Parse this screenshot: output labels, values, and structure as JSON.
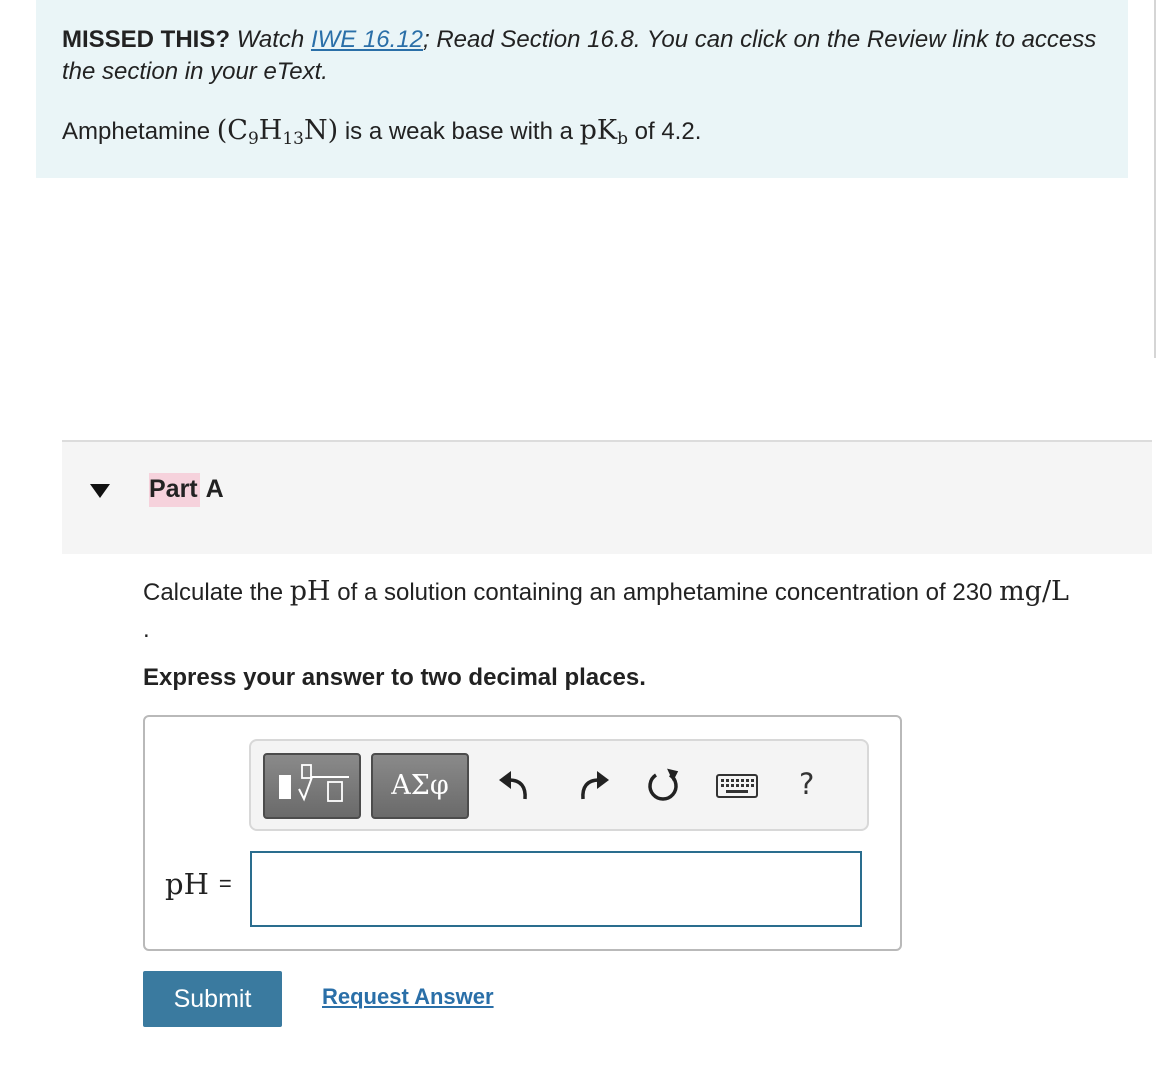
{
  "intro": {
    "missed_lead": "MISSED THIS?",
    "watch_prefix": "Watch",
    "watch_link": "IWE 16.12",
    "missed_rest": "; Read Section 16.8. You can click on the Review link to access the section in your eText.",
    "amph_prefix": "Amphetamine",
    "formula_open": "(C",
    "formula_sub1": "9",
    "formula_mid": "H",
    "formula_sub2": "13",
    "formula_close": "N)",
    "amph_mid": "is a weak base with a",
    "pkb_main": "pK",
    "pkb_sub": "b",
    "amph_suffix": "of 4.2."
  },
  "part": {
    "label_highlight": "Part",
    "label_rest": "A"
  },
  "question": {
    "prefix": "Calculate the",
    "ph": "pH",
    "middle": "of a solution containing an amphetamine concentration of 230",
    "unit": "mg/L",
    "trailing": ".",
    "instruction": "Express your answer to two decimal places."
  },
  "toolbar": {
    "greek_label": "ΑΣφ",
    "help_label": "?",
    "icons": [
      "templates-icon",
      "greek-symbols-icon",
      "undo-icon",
      "redo-icon",
      "reset-icon",
      "keyboard-icon",
      "help-icon"
    ]
  },
  "answer": {
    "label": "pH",
    "equals": "=",
    "value": ""
  },
  "actions": {
    "submit_label": "Submit",
    "request_label": "Request Answer"
  },
  "colors": {
    "intro_bg": "#eaf5f7",
    "link": "#2a6fa8",
    "part_highlight": "#f6d2dc",
    "submit_bg": "#3a7a9f",
    "input_border": "#2a6d8e"
  }
}
